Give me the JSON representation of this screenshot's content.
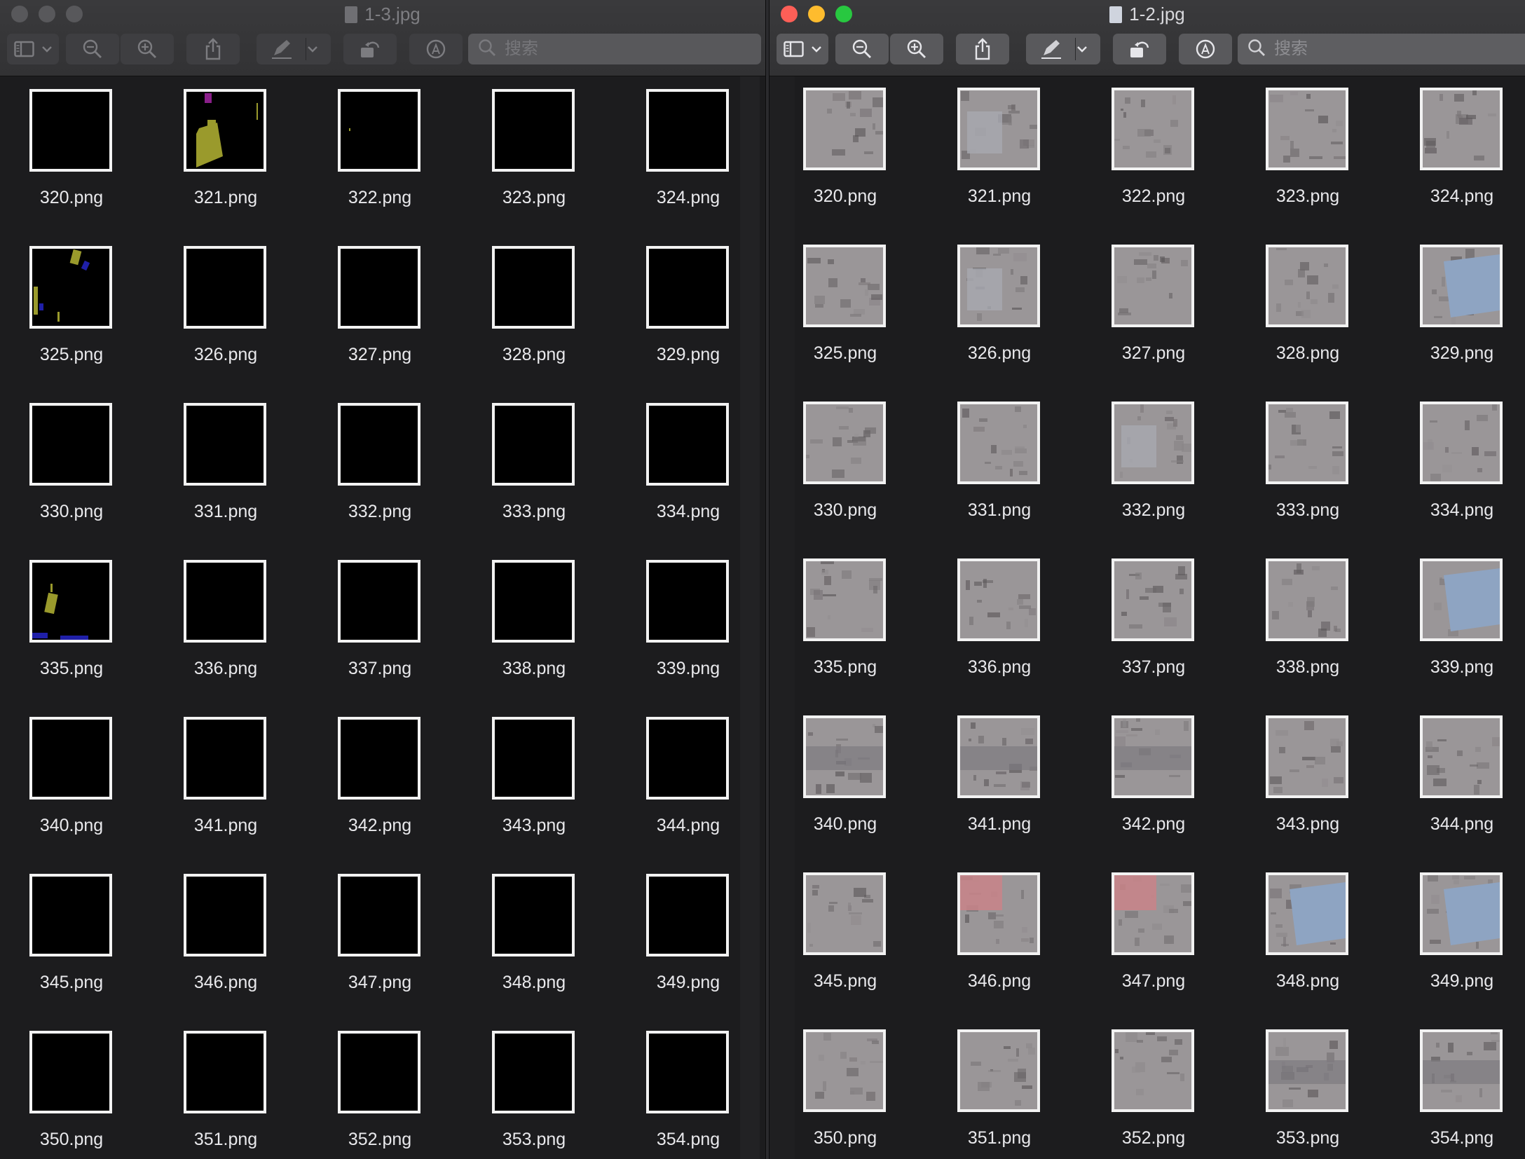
{
  "windows": [
    {
      "id": "left",
      "title": "1-3.jpg",
      "active": false,
      "search_placeholder": "搜索",
      "items": [
        {
          "label": "320.png",
          "kind": "mask",
          "v": 0
        },
        {
          "label": "321.png",
          "kind": "mask",
          "v": 1
        },
        {
          "label": "322.png",
          "kind": "mask",
          "v": 2
        },
        {
          "label": "323.png",
          "kind": "mask",
          "v": 0
        },
        {
          "label": "324.png",
          "kind": "mask",
          "v": 3
        },
        {
          "label": "325.png",
          "kind": "mask",
          "v": 4
        },
        {
          "label": "326.png",
          "kind": "mask",
          "v": 0
        },
        {
          "label": "327.png",
          "kind": "mask",
          "v": 0
        },
        {
          "label": "328.png",
          "kind": "mask",
          "v": 0
        },
        {
          "label": "329.png",
          "kind": "mask",
          "v": 0
        },
        {
          "label": "330.png",
          "kind": "mask",
          "v": 0
        },
        {
          "label": "331.png",
          "kind": "mask",
          "v": 0
        },
        {
          "label": "332.png",
          "kind": "mask",
          "v": 0
        },
        {
          "label": "333.png",
          "kind": "mask",
          "v": 0
        },
        {
          "label": "334.png",
          "kind": "mask",
          "v": 0
        },
        {
          "label": "335.png",
          "kind": "mask",
          "v": 5
        },
        {
          "label": "336.png",
          "kind": "mask",
          "v": 6
        },
        {
          "label": "337.png",
          "kind": "mask",
          "v": 0
        },
        {
          "label": "338.png",
          "kind": "mask",
          "v": 0
        },
        {
          "label": "339.png",
          "kind": "mask",
          "v": 0
        },
        {
          "label": "340.png",
          "kind": "mask",
          "v": 0
        },
        {
          "label": "341.png",
          "kind": "mask",
          "v": 0
        },
        {
          "label": "342.png",
          "kind": "mask",
          "v": 0
        },
        {
          "label": "343.png",
          "kind": "mask",
          "v": 0
        },
        {
          "label": "344.png",
          "kind": "mask",
          "v": 7
        },
        {
          "label": "345.png",
          "kind": "mask",
          "v": 8
        },
        {
          "label": "346.png",
          "kind": "mask",
          "v": 0
        },
        {
          "label": "347.png",
          "kind": "mask",
          "v": 9
        },
        {
          "label": "348.png",
          "kind": "mask",
          "v": 0
        },
        {
          "label": "349.png",
          "kind": "mask",
          "v": 0
        },
        {
          "label": "350.png",
          "kind": "mask",
          "v": 0
        },
        {
          "label": "351.png",
          "kind": "mask",
          "v": 10
        },
        {
          "label": "352.png",
          "kind": "mask",
          "v": 11
        },
        {
          "label": "353.png",
          "kind": "mask",
          "v": 0
        },
        {
          "label": "354.png",
          "kind": "mask",
          "v": 0
        }
      ]
    },
    {
      "id": "right",
      "title": "1-2.jpg",
      "active": true,
      "search_placeholder": "搜索",
      "items": [
        {
          "label": "320.png",
          "kind": "photo",
          "v": 0
        },
        {
          "label": "321.png",
          "kind": "photo",
          "v": 1
        },
        {
          "label": "322.png",
          "kind": "photo",
          "v": 2
        },
        {
          "label": "323.png",
          "kind": "photo",
          "v": 3
        },
        {
          "label": "324.png",
          "kind": "photo",
          "v": 4
        },
        {
          "label": "325.png",
          "kind": "photo",
          "v": 5
        },
        {
          "label": "326.png",
          "kind": "photo",
          "v": 6
        },
        {
          "label": "327.png",
          "kind": "photo",
          "v": 7
        },
        {
          "label": "328.png",
          "kind": "photo",
          "v": 8
        },
        {
          "label": "329.png",
          "kind": "photo",
          "v": 9
        },
        {
          "label": "330.png",
          "kind": "photo",
          "v": 10
        },
        {
          "label": "331.png",
          "kind": "photo",
          "v": 11
        },
        {
          "label": "332.png",
          "kind": "photo",
          "v": 12
        },
        {
          "label": "333.png",
          "kind": "photo",
          "v": 13
        },
        {
          "label": "334.png",
          "kind": "photo",
          "v": 14
        },
        {
          "label": "335.png",
          "kind": "photo",
          "v": 15
        },
        {
          "label": "336.png",
          "kind": "photo",
          "v": 16
        },
        {
          "label": "337.png",
          "kind": "photo",
          "v": 17
        },
        {
          "label": "338.png",
          "kind": "photo",
          "v": 18
        },
        {
          "label": "339.png",
          "kind": "photo",
          "v": 19
        },
        {
          "label": "340.png",
          "kind": "photo",
          "v": 20
        },
        {
          "label": "341.png",
          "kind": "photo",
          "v": 21
        },
        {
          "label": "342.png",
          "kind": "photo",
          "v": 22
        },
        {
          "label": "343.png",
          "kind": "photo",
          "v": 23
        },
        {
          "label": "344.png",
          "kind": "photo",
          "v": 24
        },
        {
          "label": "345.png",
          "kind": "photo",
          "v": 25
        },
        {
          "label": "346.png",
          "kind": "photo",
          "v": 26
        },
        {
          "label": "347.png",
          "kind": "photo",
          "v": 27
        },
        {
          "label": "348.png",
          "kind": "photo",
          "v": 28
        },
        {
          "label": "349.png",
          "kind": "photo",
          "v": 29
        },
        {
          "label": "350.png",
          "kind": "photo",
          "v": 30
        },
        {
          "label": "351.png",
          "kind": "photo",
          "v": 31
        },
        {
          "label": "352.png",
          "kind": "photo",
          "v": 32
        },
        {
          "label": "353.png",
          "kind": "photo",
          "v": 33
        },
        {
          "label": "354.png",
          "kind": "photo",
          "v": 34
        }
      ]
    }
  ],
  "colors": {
    "mask_background": "#000000",
    "mask_building": "#9a9a2c",
    "mask_vehicle": "#1f1fa8",
    "mask_special": "#8a1f8a",
    "photo_ground": "#9a9698",
    "photo_roof_blue": "#8ea4c2",
    "photo_roof_red": "#c98488"
  },
  "icons": {
    "toolbar": [
      "sidebar-icon",
      "chevron-down-icon",
      "zoom-out-icon",
      "zoom-in-icon",
      "share-icon",
      "markup-pen-icon",
      "rotate-icon",
      "annotate-icon",
      "search-icon"
    ],
    "title": "document-icon"
  }
}
